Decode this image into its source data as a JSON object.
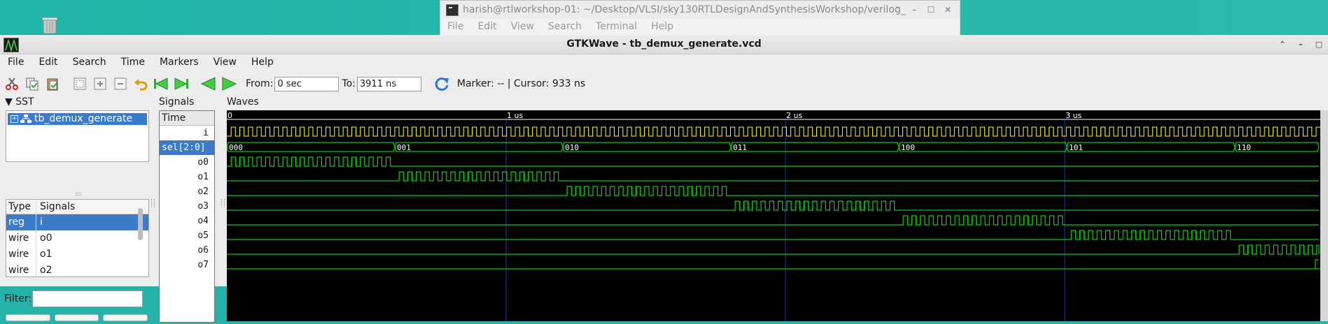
{
  "terminal": {
    "title": "harish@rtlworkshop-01: ~/Desktop/VLSI/sky130RTLDesignAndSynthesisWorkshop/verilog_",
    "menu": [
      "File",
      "Edit",
      "View",
      "Search",
      "Terminal",
      "Help"
    ]
  },
  "window": {
    "title": "GTKWave - tb_demux_generate.vcd"
  },
  "menu": [
    "File",
    "Edit",
    "Search",
    "Time",
    "Markers",
    "View",
    "Help"
  ],
  "toolbar": {
    "from_label": "From:",
    "from_value": "0 sec",
    "to_label": "To:",
    "to_value": "3911 ns",
    "marker_text": "Marker: --  |  Cursor: 933 ns"
  },
  "sst": {
    "header": "SST",
    "tree_item": "tb_demux_generate",
    "columns": [
      "Type",
      "Signals"
    ],
    "rows": [
      {
        "type": "reg",
        "name": "i"
      },
      {
        "type": "wire",
        "name": "o0"
      },
      {
        "type": "wire",
        "name": "o1"
      },
      {
        "type": "wire",
        "name": "o2"
      }
    ],
    "filter_label": "Filter:"
  },
  "signals": {
    "header": "Signals",
    "time_label": "Time",
    "names": [
      "i",
      "sel[2:0]",
      "o0",
      "o1",
      "o2",
      "o3",
      "o4",
      "o5",
      "o6",
      "o7"
    ]
  },
  "waves": {
    "header": "Waves",
    "time_labels": [
      "0",
      "1 us",
      "2 us",
      "3 us"
    ],
    "sel_values": [
      "000",
      "001",
      "010",
      "011",
      "100",
      "101",
      "110"
    ],
    "colors": {
      "clock": "#ffff00",
      "signal": "#00ff00",
      "bus": "#00ff00",
      "grid": "#2030c0",
      "background": "#000000",
      "selection": "#3b7bcc"
    }
  }
}
